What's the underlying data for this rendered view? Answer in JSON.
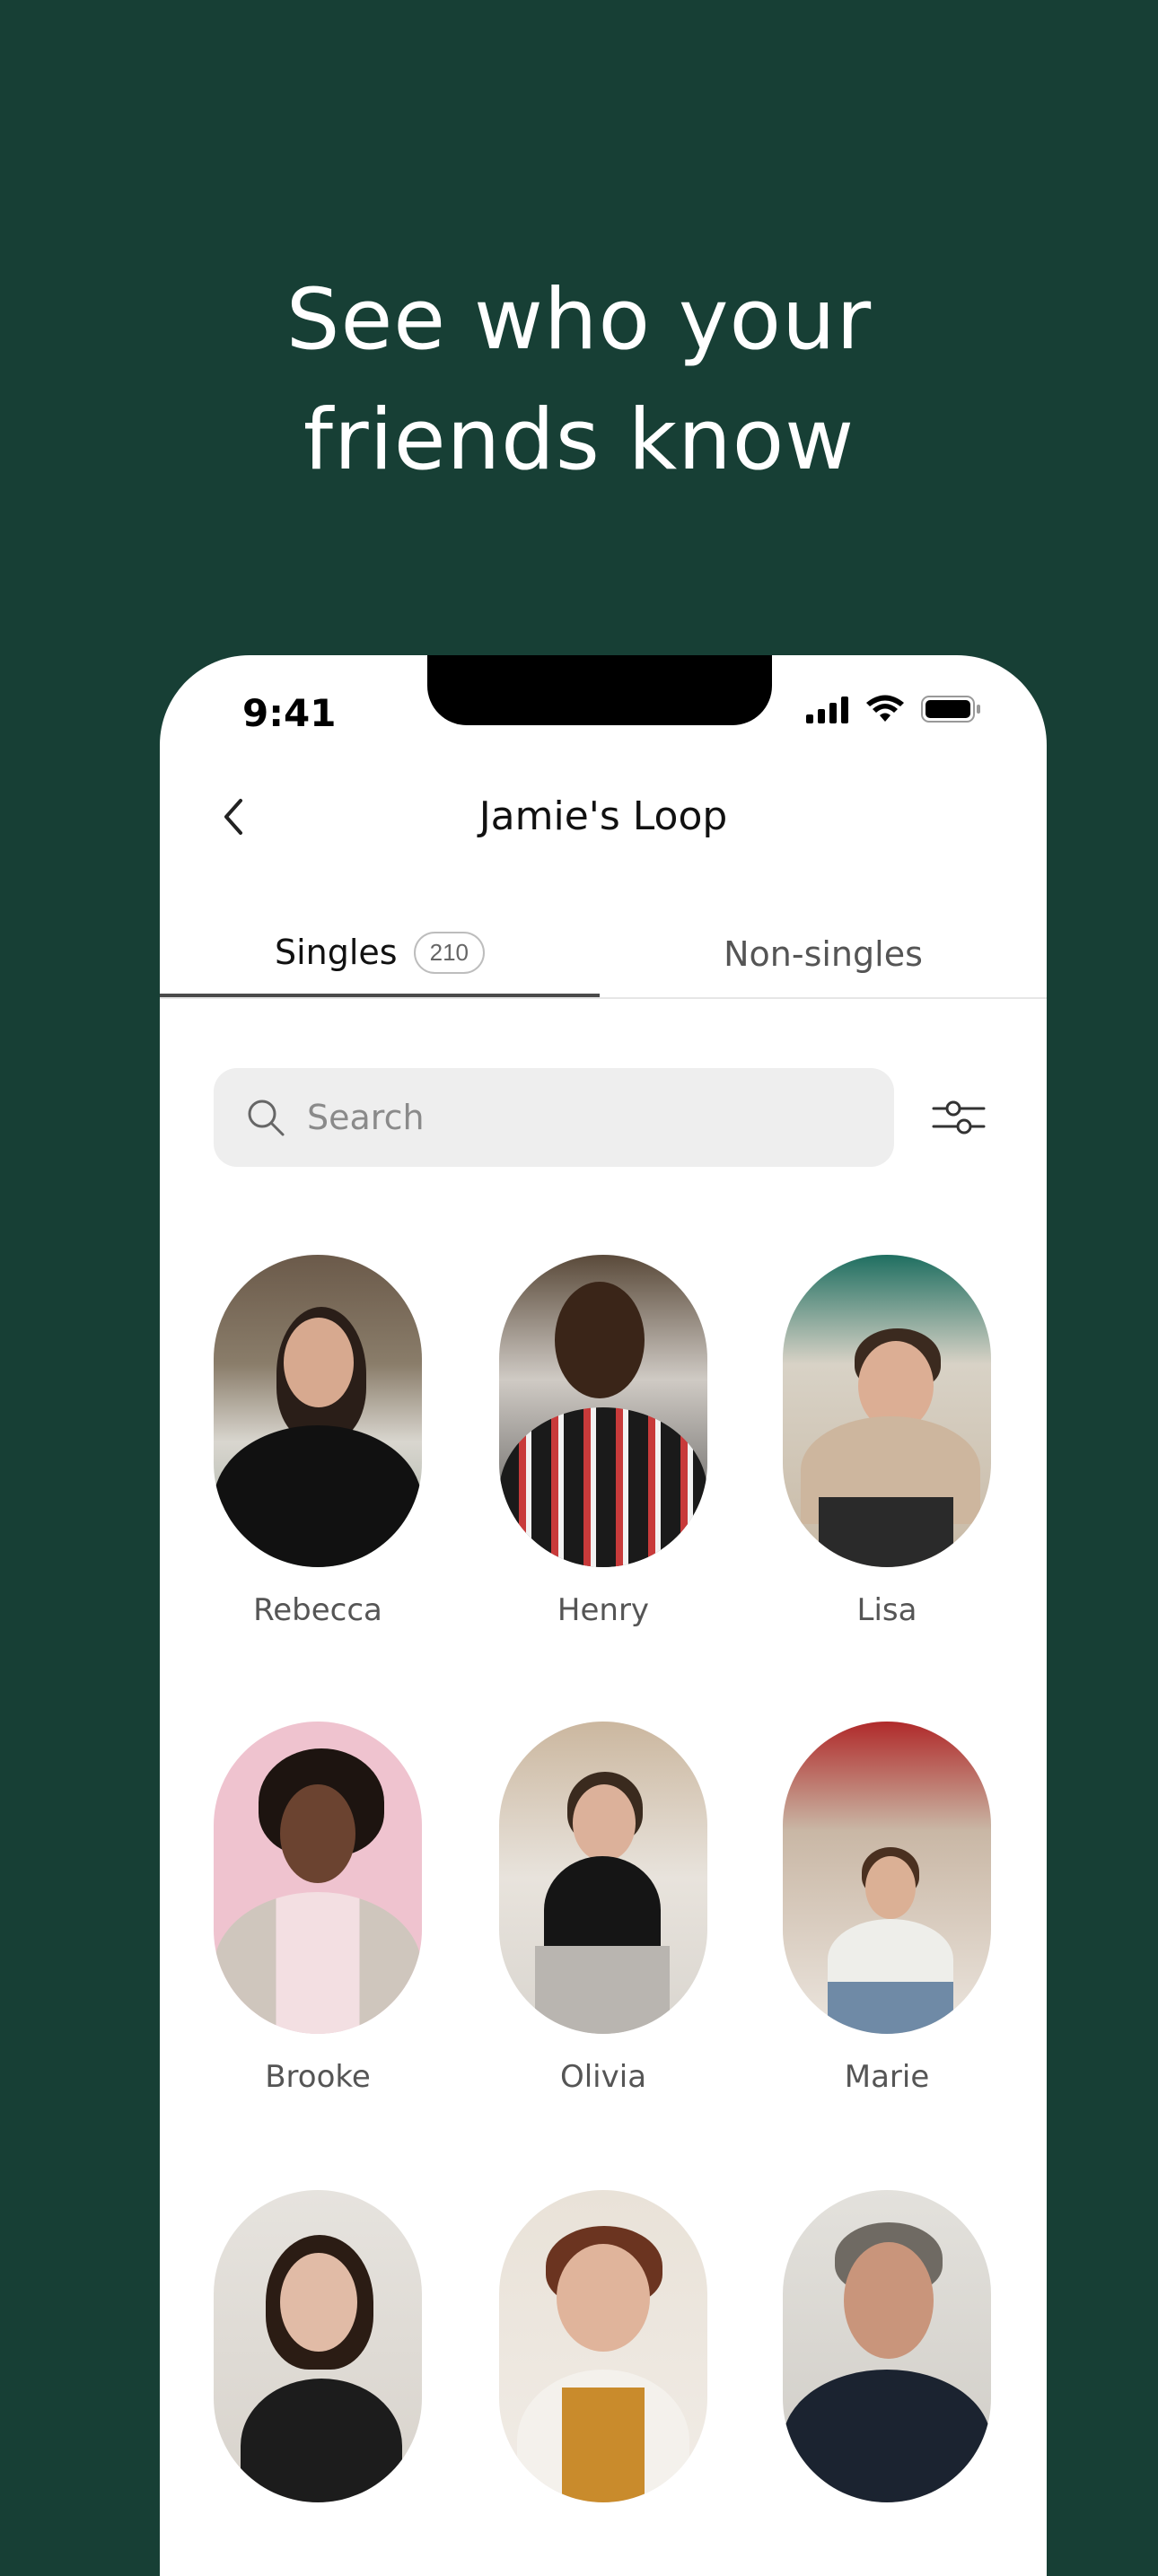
{
  "headline": {
    "line1": "See who your",
    "line2": "friends know"
  },
  "status_bar": {
    "time": "9:41",
    "icons": [
      "signal-icon",
      "wifi-icon",
      "battery-icon"
    ]
  },
  "nav": {
    "back_icon": "chevron-left-icon",
    "title": "Jamie's Loop"
  },
  "tabs": [
    {
      "label": "Singles",
      "count": "210",
      "active": true
    },
    {
      "label": "Non-singles",
      "active": false
    }
  ],
  "search": {
    "placeholder": "Search",
    "filter_icon": "sliders-icon"
  },
  "people": [
    {
      "name": "Rebecca"
    },
    {
      "name": "Henry"
    },
    {
      "name": "Lisa"
    },
    {
      "name": "Brooke"
    },
    {
      "name": "Olivia"
    },
    {
      "name": "Marie"
    },
    {
      "name": ""
    },
    {
      "name": ""
    },
    {
      "name": ""
    }
  ],
  "colors": {
    "background": "#173f35",
    "card": "#ffffff",
    "search_bg": "#eeeeee"
  }
}
